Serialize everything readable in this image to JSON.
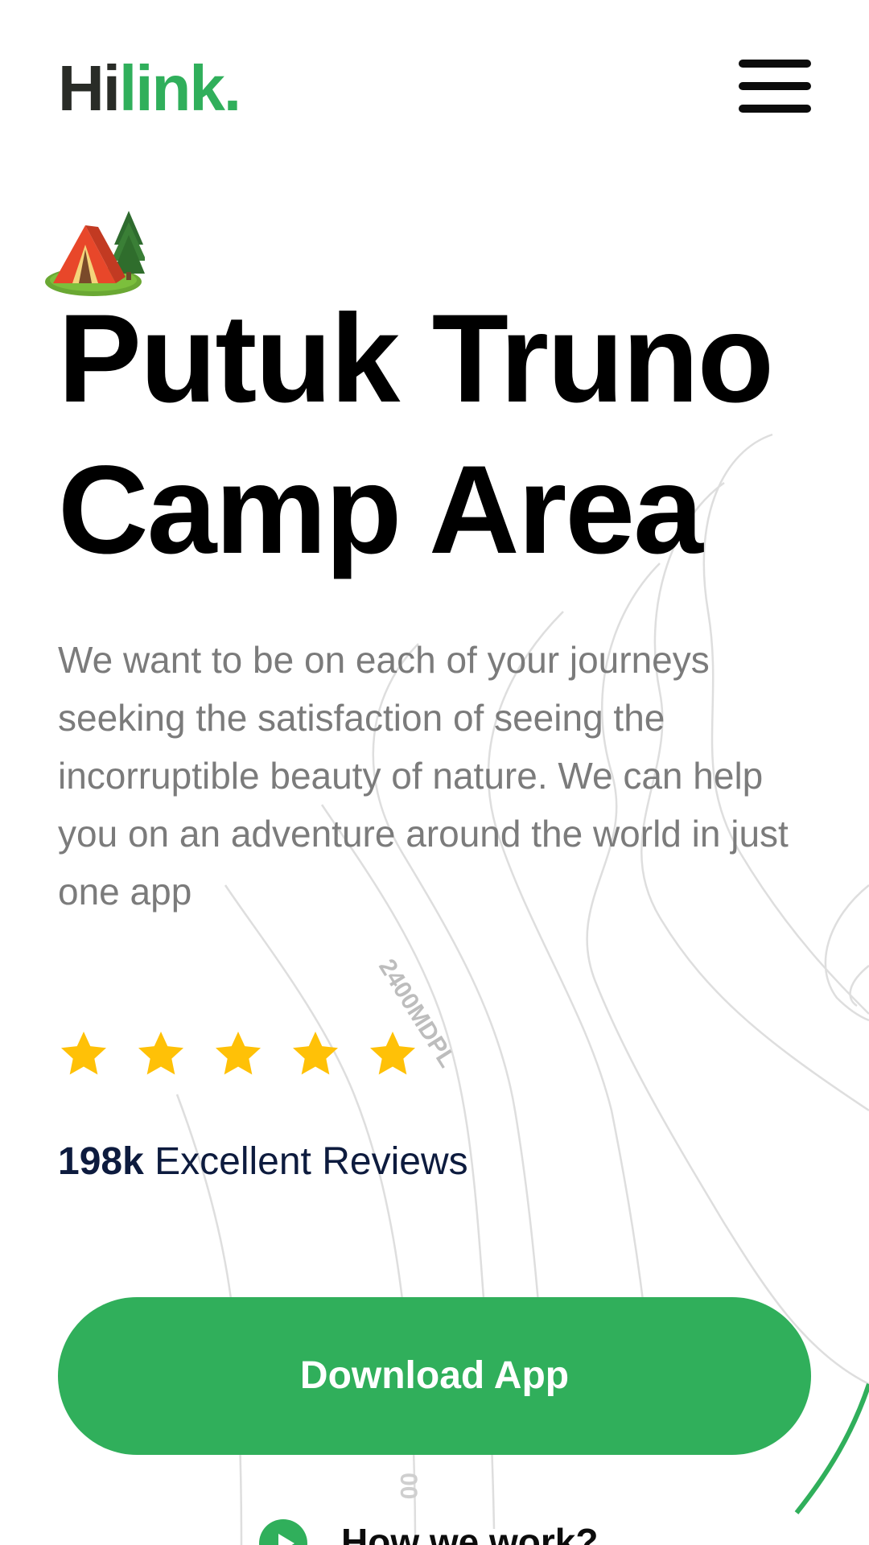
{
  "header": {
    "logo_prefix": "Hi",
    "logo_suffix": "link."
  },
  "hero": {
    "icon": "camping-tent-icon",
    "title_line1": "Putuk Truno",
    "title_line2": "Camp Area",
    "description": "We want to be on each of your journeys seeking the satisfaction of seeing the incorruptible beauty of nature. We can help you on an adventure around the world in just one app",
    "rating": 5,
    "rating_max": 5,
    "reviews_count": "198k",
    "reviews_label": "Excellent Reviews",
    "download_label": "Download App",
    "how_we_work_label": "How we work?"
  },
  "background": {
    "map_label": "2400MDPL",
    "map_label_2": "00"
  },
  "colors": {
    "accent_green": "#30af5b",
    "star_yellow": "#ffc107",
    "logo_dark": "#292c27",
    "title": "#000000",
    "description": "#7b7b7b",
    "reviews_text": "#0d1b3e"
  }
}
